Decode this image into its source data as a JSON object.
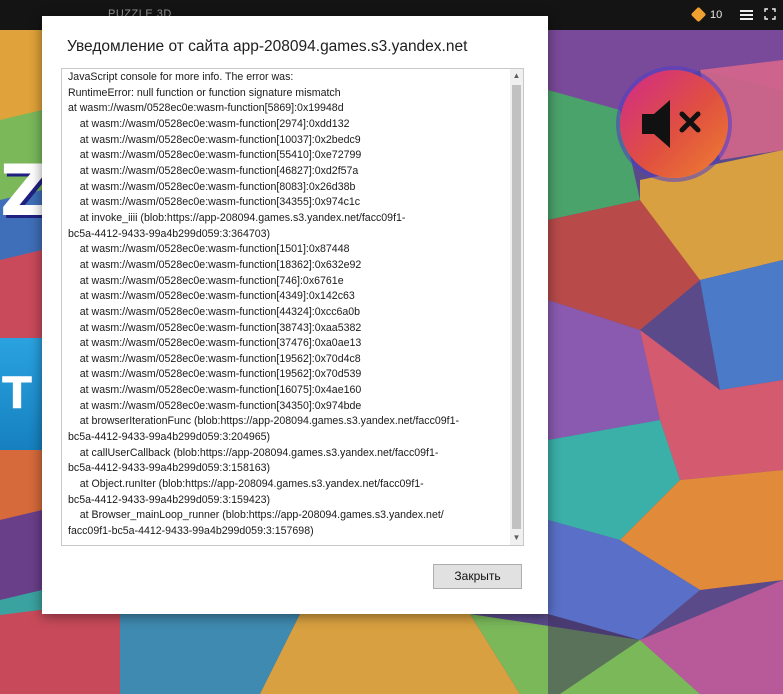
{
  "game": {
    "title": "PUZZLE 3D",
    "coins": "10",
    "logo_letter": "Z",
    "banner_letter": "T"
  },
  "icons": {
    "coin": "coin-icon",
    "menu": "hamburger-menu-icon",
    "expand": "fullscreen-icon",
    "sound": "speaker-muted-icon"
  },
  "colors": {
    "dialog_bg": "#ffffff",
    "button_bg": "#e1e1e1",
    "scroll_thumb": "#c1c1c1",
    "sound_gradient": [
      "#d12a8a",
      "#f08030"
    ]
  },
  "dialog": {
    "title": "Уведомление от сайта app-208094.games.s3.yandex.net",
    "log_lines": [
      "JavaScript console for more info. The error was:",
      "RuntimeError: null function or function signature mismatch",
      "at wasm://wasm/0528ec0e:wasm-function[5869]:0x19948d",
      "    at wasm://wasm/0528ec0e:wasm-function[2974]:0xdd132",
      "    at wasm://wasm/0528ec0e:wasm-function[10037]:0x2bedc9",
      "    at wasm://wasm/0528ec0e:wasm-function[55410]:0xe72799",
      "    at wasm://wasm/0528ec0e:wasm-function[46827]:0xd2f57a",
      "    at wasm://wasm/0528ec0e:wasm-function[8083]:0x26d38b",
      "    at wasm://wasm/0528ec0e:wasm-function[34355]:0x974c1c",
      "    at invoke_iiii (blob:https://app-208094.games.s3.yandex.net/facc09f1-",
      "bc5a-4412-9433-99a4b299d059:3:364703)",
      "    at wasm://wasm/0528ec0e:wasm-function[1501]:0x87448",
      "    at wasm://wasm/0528ec0e:wasm-function[18362]:0x632e92",
      "    at wasm://wasm/0528ec0e:wasm-function[746]:0x6761e",
      "    at wasm://wasm/0528ec0e:wasm-function[4349]:0x142c63",
      "    at wasm://wasm/0528ec0e:wasm-function[44324]:0xcc6a0b",
      "    at wasm://wasm/0528ec0e:wasm-function[38743]:0xaa5382",
      "    at wasm://wasm/0528ec0e:wasm-function[37476]:0xa0ae13",
      "    at wasm://wasm/0528ec0e:wasm-function[19562]:0x70d4c8",
      "    at wasm://wasm/0528ec0e:wasm-function[19562]:0x70d539",
      "    at wasm://wasm/0528ec0e:wasm-function[16075]:0x4ae160",
      "    at wasm://wasm/0528ec0e:wasm-function[34350]:0x974bde",
      "    at browserIterationFunc (blob:https://app-208094.games.s3.yandex.net/facc09f1-",
      "bc5a-4412-9433-99a4b299d059:3:204965)",
      "    at callUserCallback (blob:https://app-208094.games.s3.yandex.net/facc09f1-",
      "bc5a-4412-9433-99a4b299d059:3:158163)",
      "    at Object.runIter (blob:https://app-208094.games.s3.yandex.net/facc09f1-",
      "bc5a-4412-9433-99a4b299d059:3:159423)",
      "    at Browser_mainLoop_runner (blob:https://app-208094.games.s3.yandex.net/",
      "facc09f1-bc5a-4412-9433-99a4b299d059:3:157698)"
    ],
    "close_label": "Закрыть"
  }
}
